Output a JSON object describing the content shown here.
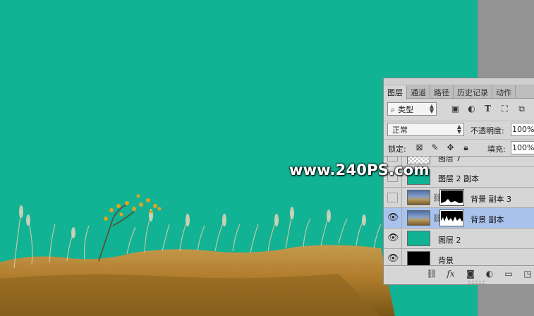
{
  "watermark": "www.240PS.com",
  "panel": {
    "tabs": [
      "图层",
      "通道",
      "路径",
      "历史记录",
      "动作"
    ],
    "filter": {
      "label": "类型",
      "search_icon": "magnifier-icon",
      "icons": [
        "image-filter-icon",
        "adjustment-filter-icon",
        "type-filter-icon",
        "shape-filter-icon",
        "smart-object-filter-icon"
      ]
    },
    "blend_mode": "正常",
    "opacity_label": "不透明度:",
    "opacity_value": "100%",
    "lock_label": "锁定:",
    "fill_label": "填充:",
    "fill_value": "100%",
    "layers": [
      {
        "name": "图层 7",
        "visible": false,
        "thumb": "checker",
        "selected": false
      },
      {
        "name": "图层 2 副本",
        "visible": false,
        "thumb": "green",
        "selected": false
      },
      {
        "name": "背景 副本 3",
        "visible": false,
        "thumb": "photo",
        "has_mask": true,
        "selected": false
      },
      {
        "name": "背景 副本",
        "visible": true,
        "thumb": "photo",
        "has_mask": true,
        "selected": true
      },
      {
        "name": "图层 2",
        "visible": true,
        "thumb": "green",
        "selected": false
      },
      {
        "name": "背景",
        "visible": true,
        "thumb": "black",
        "selected": false
      }
    ],
    "bottom_icons": [
      "link-layers-icon",
      "fx-icon",
      "add-mask-icon",
      "adjustment-layer-icon",
      "group-folder-icon",
      "new-layer-icon"
    ],
    "fx_label": "fx"
  },
  "colors": {
    "canvas": "#12b294",
    "workspace": "#939393",
    "selected_layer": "#a9c3ec"
  }
}
